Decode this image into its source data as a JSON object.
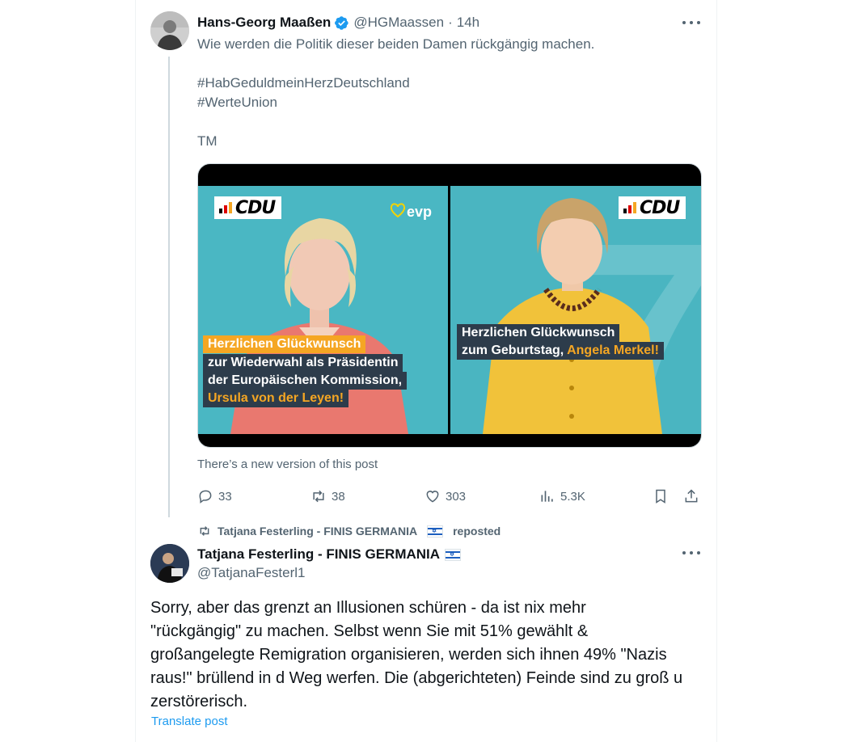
{
  "tweet": {
    "author_name": "Hans-Georg Maaßen",
    "handle": "@HGMaassen",
    "separator": "·",
    "time": "14h",
    "text_line1": "Wie werden die Politik dieser beiden Damen rückgängig machen.",
    "hashtag1": "#HabGeduldmeinHerzDeutschland",
    "hashtag2": "#WerteUnion",
    "signature": "TM",
    "media": {
      "left": {
        "logo": "CDU",
        "party_logo": "evp",
        "caption_orange": "Herzlichen Glückwunsch",
        "caption_dark1": "zur Wiederwahl als Präsidentin",
        "caption_dark2": "der Europäischen Kommission,",
        "caption_orange2": "Ursula von der Leyen!",
        "bg_color": "#4ab7c3"
      },
      "right": {
        "logo": "CDU",
        "caption_line1": "Herzlichen Glückwunsch",
        "caption_line2_white": "zum Geburtstag,",
        "caption_line2_orange": "Angela Merkel!",
        "bg_color": "#4ab5c1"
      }
    },
    "new_version_note": "There’s a new version of this post",
    "stats": {
      "replies": "33",
      "reposts": "38",
      "likes": "303",
      "views": "5.3K"
    },
    "icons": [
      "verified-badge-icon",
      "more-icon",
      "reply-icon",
      "repost-icon",
      "like-icon",
      "views-icon",
      "bookmark-icon",
      "share-icon"
    ]
  },
  "reply": {
    "repost_label_name": "Tatjana Festerling - FINIS GERMANIA",
    "repost_label_suffix": "reposted",
    "author_name": "Tatjana Festerling - FINIS GERMANIA",
    "handle": "@TatjanaFesterl1",
    "line1": "Sorry, aber das grenzt an Illusionen schüren - da ist nix mehr",
    "line2": "\"rückgängig\" zu machen. Selbst wenn Sie mit 51% gewählt &",
    "line3": "großangelegte Remigration organisieren, werden sich ihnen 49% \"Nazis",
    "line4": "raus!\" brüllend in d Weg werfen. Die (abgerichteten) Feinde sind zu groß u",
    "line5": "zerstörerisch.",
    "translate": "Translate post"
  },
  "colors": {
    "accent": "#1d9bf0",
    "muted": "#536471",
    "cdu_orange": "#f5a623",
    "caption_dark": "#2d3c4b"
  }
}
